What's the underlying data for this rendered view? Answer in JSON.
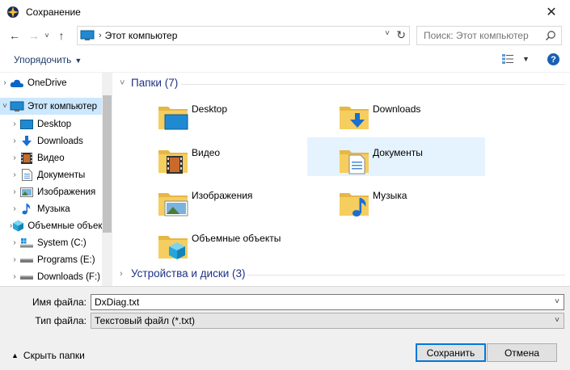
{
  "window": {
    "title": "Сохранение"
  },
  "address": {
    "path": "Этот компьютер"
  },
  "search": {
    "placeholder": "Поиск: Этот компьютер"
  },
  "toolbar": {
    "organize_label": "Упорядочить"
  },
  "sidebar": {
    "items": [
      {
        "label": "OneDrive",
        "icon": "onedrive-icon"
      },
      {
        "label": "Этот компьютер",
        "icon": "computer-icon",
        "selected": true
      },
      {
        "label": "Desktop",
        "icon": "desktop-icon"
      },
      {
        "label": "Downloads",
        "icon": "downloads-icon"
      },
      {
        "label": "Видео",
        "icon": "video-icon"
      },
      {
        "label": "Документы",
        "icon": "documents-icon"
      },
      {
        "label": "Изображения",
        "icon": "pictures-icon"
      },
      {
        "label": "Музыка",
        "icon": "music-icon"
      },
      {
        "label": "Объемные объекты",
        "icon": "3d-objects-icon"
      },
      {
        "label": "System (C:)",
        "icon": "system-drive-icon"
      },
      {
        "label": "Programs (E:)",
        "icon": "drive-icon"
      },
      {
        "label": "Downloads (F:)",
        "icon": "drive-icon"
      }
    ]
  },
  "content": {
    "folders_header": "Папки (7)",
    "devices_header": "Устройства и диски (3)",
    "folders": [
      {
        "label": "Desktop",
        "icon": "desktop-folder-icon"
      },
      {
        "label": "Downloads",
        "icon": "downloads-folder-icon"
      },
      {
        "label": "Видео",
        "icon": "video-folder-icon"
      },
      {
        "label": "Документы",
        "icon": "documents-folder-icon",
        "selected": true
      },
      {
        "label": "Изображения",
        "icon": "pictures-folder-icon"
      },
      {
        "label": "Музыка",
        "icon": "music-folder-icon"
      },
      {
        "label": "Объемные объекты",
        "icon": "3d-objects-folder-icon"
      }
    ]
  },
  "form": {
    "filename_label": "Имя файла:",
    "filename_value": "DxDiag.txt",
    "filetype_label": "Тип файла:",
    "filetype_value": "Текстовый файл (*.txt)",
    "hide_folders_label": "Скрыть папки",
    "save_label": "Сохранить",
    "cancel_label": "Отмена"
  },
  "colors": {
    "accent": "#0078d7",
    "selection": "#cce8ff",
    "header_text": "#1e3287"
  }
}
